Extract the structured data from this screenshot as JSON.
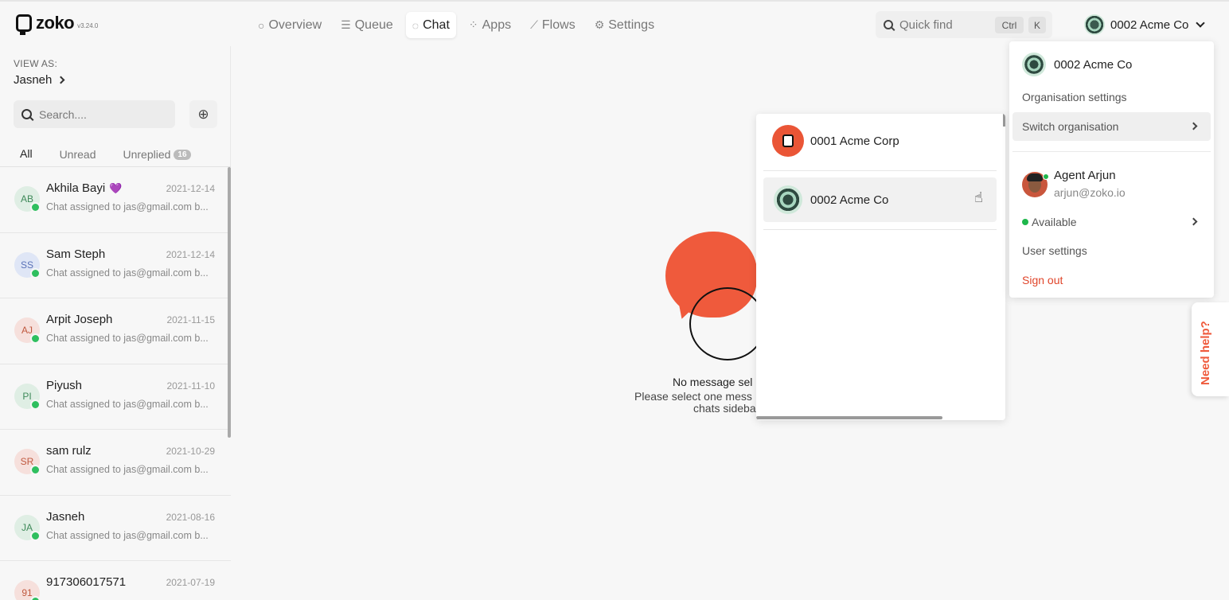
{
  "app": {
    "name": "zoko",
    "version": "v3.24.0"
  },
  "nav": [
    {
      "label": "Overview",
      "icon": "circle-icon"
    },
    {
      "label": "Queue",
      "icon": "queue-icon"
    },
    {
      "label": "Chat",
      "icon": "chat-icon",
      "active": true
    },
    {
      "label": "Apps",
      "icon": "apps-grid-icon"
    },
    {
      "label": "Flows",
      "icon": "flows-icon"
    },
    {
      "label": "Settings",
      "icon": "gear-icon"
    }
  ],
  "quick_find": {
    "placeholder": "Quick find",
    "key1": "Ctrl",
    "key2": "K"
  },
  "current_org": "0002 Acme Co",
  "sidebar": {
    "view_as_label": "VIEW AS:",
    "view_as_user": "Jasneh",
    "search_placeholder": "Search....",
    "tabs": [
      {
        "label": "All",
        "active": true
      },
      {
        "label": "Unread"
      },
      {
        "label": "Unreplied",
        "badge": "16"
      }
    ],
    "chats": [
      {
        "initials": "AB",
        "name": "Akhila Bayi",
        "heart": "💜",
        "date": "2021-12-14",
        "preview": "Chat assigned to jas@gmail.com b...",
        "bg": "#dfeee4",
        "fg": "#3f8a5a"
      },
      {
        "initials": "SS",
        "name": "Sam Steph",
        "heart": "",
        "date": "2021-12-14",
        "preview": "Chat assigned to jas@gmail.com b...",
        "bg": "#dfe6f6",
        "fg": "#5a72b8"
      },
      {
        "initials": "AJ",
        "name": "Arpit Joseph",
        "heart": "",
        "date": "2021-11-15",
        "preview": "Chat assigned to jas@gmail.com b...",
        "bg": "#f6e0dc",
        "fg": "#c0593f"
      },
      {
        "initials": "PI",
        "name": "Piyush",
        "heart": "",
        "date": "2021-11-10",
        "preview": "Chat assigned to jas@gmail.com b...",
        "bg": "#dfeee4",
        "fg": "#3f8a5a"
      },
      {
        "initials": "SR",
        "name": "sam rulz",
        "heart": "",
        "date": "2021-10-29",
        "preview": "Chat assigned to jas@gmail.com b...",
        "bg": "#f6e0dc",
        "fg": "#c0593f"
      },
      {
        "initials": "JA",
        "name": "Jasneh",
        "heart": "",
        "date": "2021-08-16",
        "preview": "Chat assigned to jas@gmail.com b...",
        "bg": "#dfeee4",
        "fg": "#3f8a5a"
      },
      {
        "initials": "91",
        "name": "917306017571",
        "heart": "",
        "date": "2021-07-19",
        "preview": "",
        "bg": "#f6e0dc",
        "fg": "#c0593f"
      }
    ]
  },
  "empty_state": {
    "title": "No message sel",
    "line1": "Please select one mess",
    "line2": "chats sideba"
  },
  "org_menu": {
    "items": [
      {
        "name": "0001 Acme Corp",
        "logo": "zoko-red-logo"
      },
      {
        "name": "0002 Acme Co",
        "logo": "green-network-logo",
        "hover": true
      }
    ]
  },
  "account_menu": {
    "org_name": "0002 Acme Co",
    "organisation_settings": "Organisation settings",
    "switch_organisation": "Switch organisation",
    "agent_name": "Agent Arjun",
    "agent_email": "arjun@zoko.io",
    "status": "Available",
    "user_settings": "User settings",
    "sign_out": "Sign out"
  },
  "need_help": "Need help?",
  "colors": {
    "accent": "#ef5a3c",
    "online": "#1eb74b",
    "whatsapp": "#2fbf5f"
  }
}
